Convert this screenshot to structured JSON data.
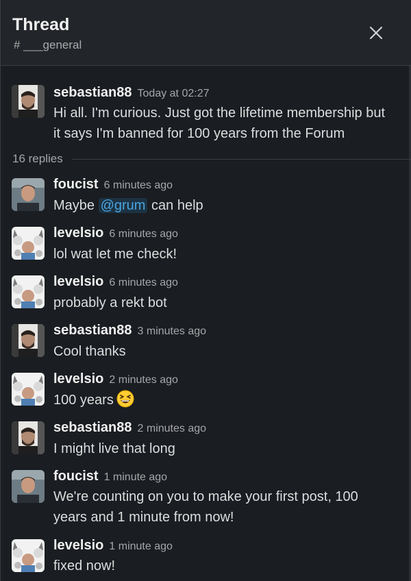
{
  "header": {
    "title": "Thread",
    "channel": "# ___general",
    "close_icon": "close-icon"
  },
  "parent": {
    "author": "sebastian88",
    "time": "Today at 02:27",
    "text": "Hi all. I'm curious. Just got the lifetime membership but it says I'm banned for 100 years from the Forum",
    "avatar": "sebastian-avatar"
  },
  "replies_label": "16 replies",
  "messages": [
    {
      "author": "foucist",
      "time": "6 minutes ago",
      "before": "Maybe ",
      "mention": "@grum",
      "after": " can help",
      "avatar": "foucist-avatar"
    },
    {
      "author": "levelsio",
      "time": "6 minutes ago",
      "text": "lol wat let me check!",
      "avatar": "levelsio-avatar"
    },
    {
      "author": "levelsio",
      "time": "6 minutes ago",
      "text": "probably a rekt bot",
      "avatar": "levelsio-avatar"
    },
    {
      "author": "sebastian88",
      "time": "3 minutes ago",
      "text": "Cool thanks",
      "avatar": "sebastian-avatar"
    },
    {
      "author": "levelsio",
      "time": "2 minutes ago",
      "text": "100 years",
      "emoji": "grinning-squinting-face-icon",
      "avatar": "levelsio-avatar"
    },
    {
      "author": "sebastian88",
      "time": "2 minutes ago",
      "text": "I might live that long",
      "avatar": "sebastian-avatar"
    },
    {
      "author": "foucist",
      "time": "1 minute ago",
      "text": "We're counting on you to make your first post, 100 years and 1 minute from now!",
      "avatar": "foucist-avatar"
    },
    {
      "author": "levelsio",
      "time": "1 minute ago",
      "text": "fixed now!",
      "avatar": "levelsio-avatar"
    }
  ],
  "colors": {
    "background": "#1a1d21",
    "header_bg": "#222529",
    "mention_bg": "#1d3242",
    "mention_text": "#4aa4e3"
  }
}
